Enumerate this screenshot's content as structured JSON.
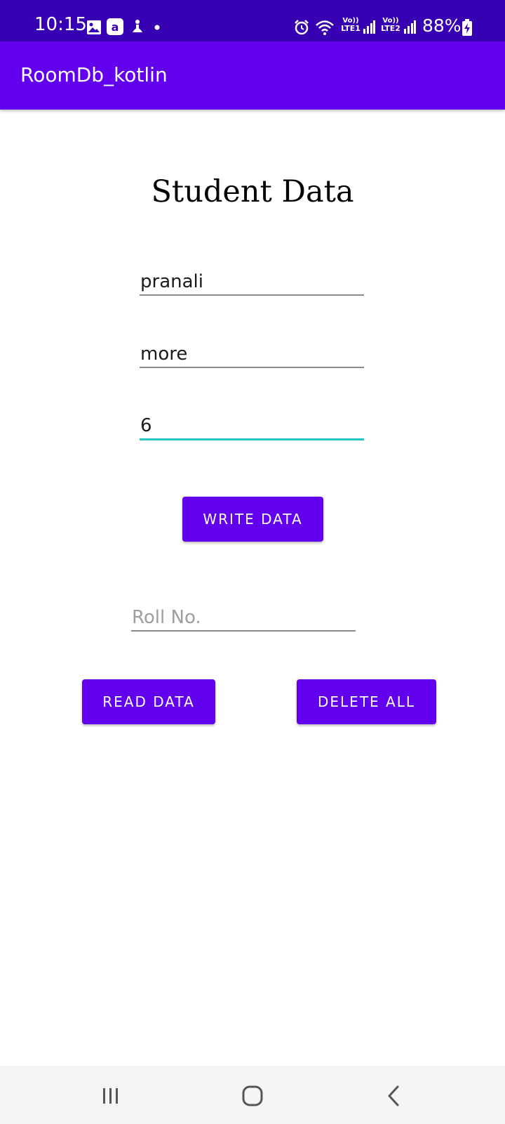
{
  "status_bar": {
    "time": "10:15",
    "sim1_label": "LTE1",
    "sim2_label": "LTE2",
    "volte_label": "Vo))",
    "battery": "88%",
    "icons": [
      "gallery-icon",
      "a-app-icon",
      "notification-icon",
      "dot-icon",
      "alarm-icon",
      "wifi-icon",
      "signal-icon",
      "battery-icon"
    ]
  },
  "app_bar": {
    "title": "RoomDb_kotlin"
  },
  "main": {
    "heading": "Student Data",
    "first_name_value": "pranali",
    "last_name_value": "more",
    "roll_value": "6",
    "write_button": "WRITE DATA",
    "roll_search_placeholder": "Roll No.",
    "read_button": "READ DATA",
    "delete_button": "DELETE ALL"
  },
  "colors": {
    "status_bar": "#3700b3",
    "primary": "#6200ee",
    "focus_underline": "#26c6c0"
  },
  "nav_bar": {
    "icons": [
      "recents-icon",
      "home-icon",
      "back-icon"
    ]
  }
}
